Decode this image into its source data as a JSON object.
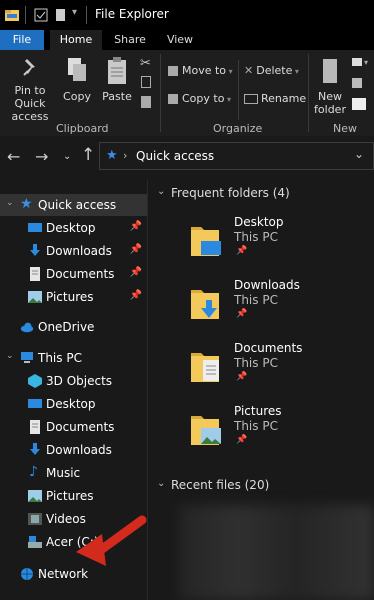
{
  "window": {
    "title": "File Explorer"
  },
  "tabs": {
    "file": "File",
    "home": "Home",
    "share": "Share",
    "view": "View"
  },
  "ribbon": {
    "pin_label": "Pin to Quick\naccess",
    "pin_line1": "Pin to Quick",
    "pin_line2": "access",
    "copy": "Copy",
    "paste": "Paste",
    "move_to": "Move to",
    "copy_to": "Copy to",
    "delete": "Delete",
    "rename": "Rename",
    "new_folder_line1": "New",
    "new_folder_line2": "folder",
    "group_clipboard": "Clipboard",
    "group_organize": "Organize",
    "group_new": "New"
  },
  "address": {
    "location": "Quick access"
  },
  "nav": {
    "quick_access": "Quick access",
    "qa_items": [
      "Desktop",
      "Downloads",
      "Documents",
      "Pictures"
    ],
    "onedrive": "OneDrive",
    "this_pc": "This PC",
    "pc_items": [
      "3D Objects",
      "Desktop",
      "Documents",
      "Downloads",
      "Music",
      "Pictures",
      "Videos",
      "Acer (C:)"
    ],
    "network": "Network"
  },
  "content": {
    "frequent_header": "Frequent folders (4)",
    "recent_header": "Recent files (20)",
    "folders": [
      {
        "name": "Desktop",
        "location": "This PC"
      },
      {
        "name": "Downloads",
        "location": "This PC"
      },
      {
        "name": "Documents",
        "location": "This PC"
      },
      {
        "name": "Pictures",
        "location": "This PC"
      }
    ]
  },
  "colors": {
    "accent": "#1e6fbf",
    "folder": "#f3c95b",
    "annotation_arrow": "#d32a1e"
  }
}
